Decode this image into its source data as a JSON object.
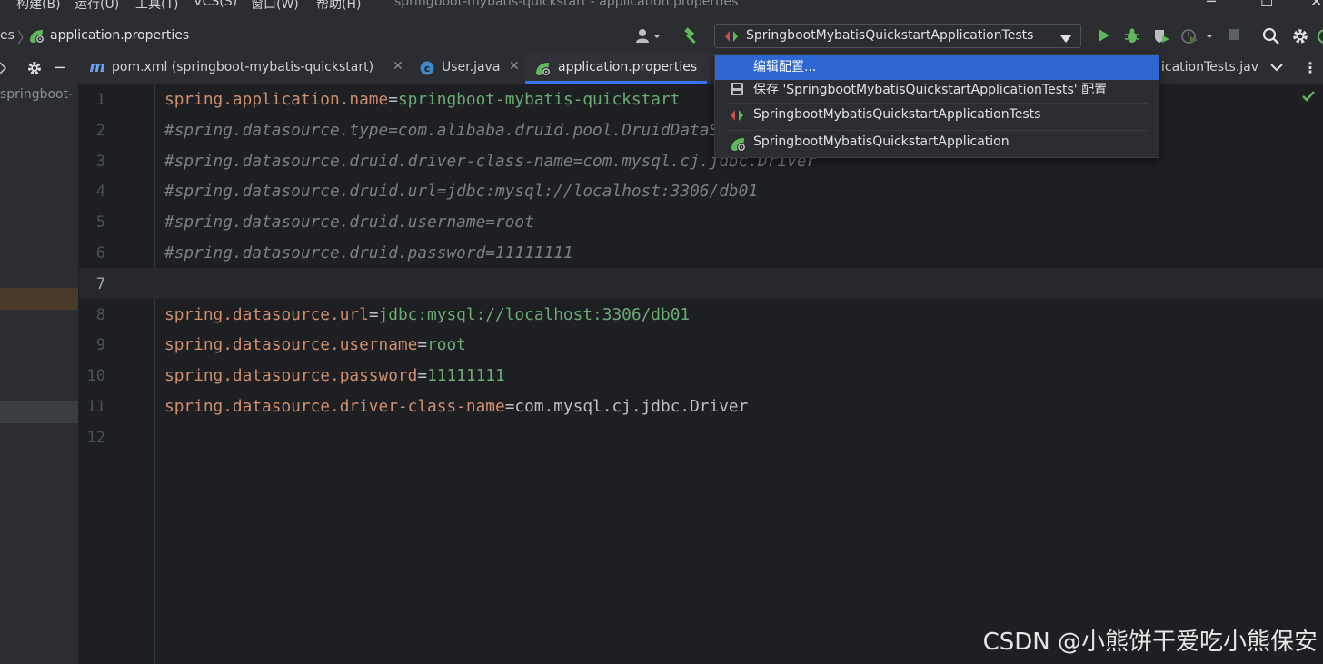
{
  "menubar": {
    "items": [
      "构建(B)",
      "运行(U)",
      "工具(T)",
      "VCS(S)",
      "窗口(W)",
      "帮助(H)"
    ],
    "window_title": "springboot-mybatis-quickstart - application.properties"
  },
  "navbar": {
    "breadcrumb_prev": "es",
    "breadcrumb_file": "application.properties",
    "run_config": "SpringbootMybatisQuickstartApplicationTests"
  },
  "tabs": [
    {
      "label": "pom.xml (springboot-mybatis-quickstart)",
      "icon": "maven-icon"
    },
    {
      "label": "User.java",
      "icon": "class-icon"
    },
    {
      "label": "application.properties",
      "icon": "spring-properties-icon",
      "active": true
    },
    {
      "label": "icationTests.jav",
      "icon": "class-icon"
    }
  ],
  "project": {
    "root_label": "springboot-"
  },
  "editor": {
    "current_line": 7,
    "line_numbers": [
      "1",
      "2",
      "3",
      "4",
      "5",
      "6",
      "7",
      "8",
      "9",
      "10",
      "11",
      "12"
    ],
    "lines": [
      {
        "key": "spring.application.name",
        "value": "springboot-mybatis-quickstart",
        "type": "prop"
      },
      {
        "text": "#spring.datasource.type=com.alibaba.druid.pool.DruidDataSource",
        "type": "comment"
      },
      {
        "text": "#spring.datasource.druid.driver-class-name=com.mysql.cj.jdbc.Driver",
        "type": "comment"
      },
      {
        "text": "#spring.datasource.druid.url=jdbc:mysql://localhost:3306/db01",
        "type": "comment"
      },
      {
        "text": "#spring.datasource.druid.username=root",
        "type": "comment"
      },
      {
        "text": "#spring.datasource.druid.password=11111111",
        "type": "comment"
      },
      {
        "text": "",
        "type": "blank"
      },
      {
        "key": "spring.datasource.url",
        "value": "jdbc:mysql://localhost:3306/db01",
        "type": "prop"
      },
      {
        "key": "spring.datasource.username",
        "value": "root",
        "type": "prop"
      },
      {
        "key": "spring.datasource.password",
        "value": "11111111",
        "type": "prop"
      },
      {
        "key": "spring.datasource.driver-class-name",
        "value": "com.mysql.cj.jdbc.Driver",
        "type": "prop-plain"
      },
      {
        "text": "",
        "type": "blank"
      }
    ]
  },
  "dropdown": {
    "items": [
      {
        "label": "编辑配置...",
        "selected": true,
        "icon": ""
      },
      {
        "label": "保存 'SpringbootMybatisQuickstartApplicationTests' 配置",
        "icon": "save-icon"
      },
      {
        "label": "SpringbootMybatisQuickstartApplicationTests",
        "icon": "test-config-icon"
      },
      {
        "label": "SpringbootMybatisQuickstartApplication",
        "icon": "spring-boot-icon"
      }
    ]
  },
  "watermark": "CSDN @小熊饼干爱吃小熊保安",
  "colors": {
    "accent": "#3574f0",
    "selection": "#2e67d2",
    "key": "#cf8e6d",
    "value": "#6aab73",
    "comment": "#7a7e85"
  }
}
